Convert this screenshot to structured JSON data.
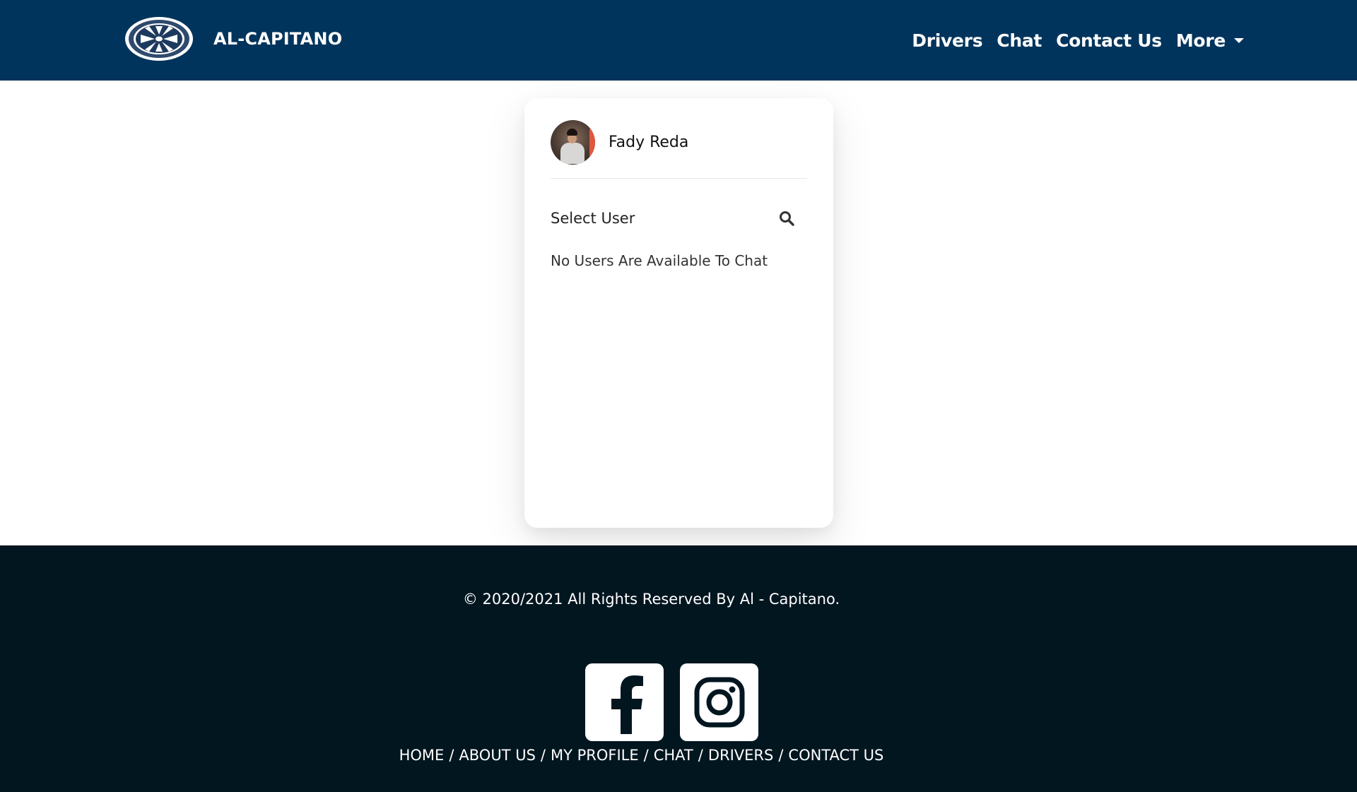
{
  "nav": {
    "brand": "AL-CAPITANO",
    "logo_icon": "car-wheel-logo-icon",
    "links": [
      {
        "label": "Drivers"
      },
      {
        "label": "Chat"
      },
      {
        "label": "Contact Us"
      },
      {
        "label": "More",
        "dropdown": true
      }
    ]
  },
  "chat_panel": {
    "current_user": {
      "name": "Fady Reda",
      "avatar_icon": "user-avatar"
    },
    "select_label": "Select User",
    "search_icon": "search-icon",
    "empty_message": "No Users Are Available To Chat"
  },
  "footer": {
    "copyright": "© 2020/2021 All Rights Reserved By Al - Capitano.",
    "social": [
      {
        "name": "facebook-icon"
      },
      {
        "name": "instagram-icon"
      }
    ],
    "links": [
      {
        "label": "HOME"
      },
      {
        "label": "ABOUT US"
      },
      {
        "label": "MY PROFILE"
      },
      {
        "label": "CHAT"
      },
      {
        "label": "DRIVERS"
      },
      {
        "label": "CONTACT US"
      }
    ],
    "separator": "/"
  },
  "colors": {
    "navbar_bg": "#01345c",
    "footer_bg": "#021620",
    "page_bg": "#ffffff"
  }
}
